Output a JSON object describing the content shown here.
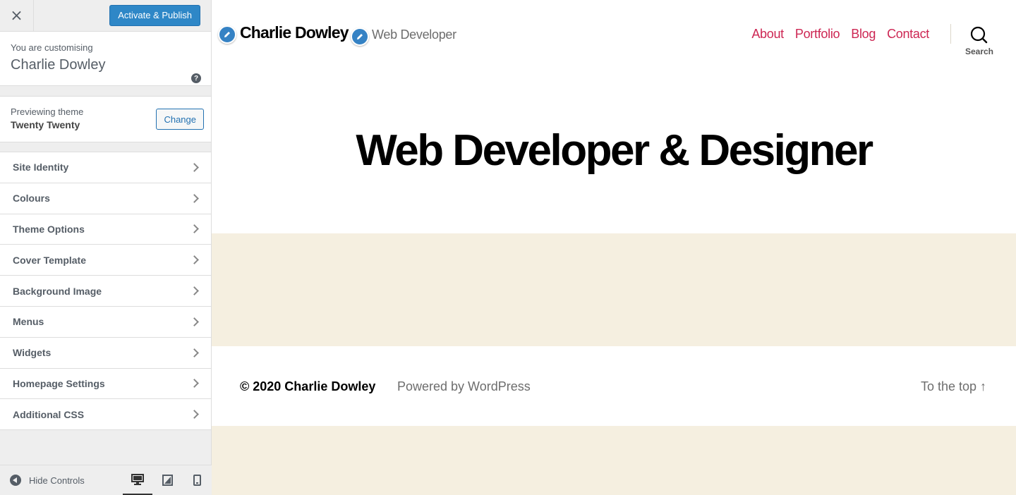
{
  "sidebar": {
    "close_label": "×",
    "publish_label": "Activate & Publish",
    "customising_label": "You are customising",
    "site_name": "Charlie Dowley",
    "help_label": "?",
    "previewing_label": "Previewing theme",
    "theme_name": "Twenty Twenty",
    "change_label": "Change",
    "items": [
      {
        "label": "Site Identity"
      },
      {
        "label": "Colours"
      },
      {
        "label": "Theme Options"
      },
      {
        "label": "Cover Template"
      },
      {
        "label": "Background Image"
      },
      {
        "label": "Menus"
      },
      {
        "label": "Widgets"
      },
      {
        "label": "Homepage Settings"
      },
      {
        "label": "Additional CSS"
      }
    ],
    "hide_controls_label": "Hide Controls",
    "active_device": "desktop"
  },
  "preview": {
    "site_title": "Charlie Dowley",
    "site_description": "Web Developer",
    "nav": [
      {
        "label": "About"
      },
      {
        "label": "Portfolio"
      },
      {
        "label": "Blog"
      },
      {
        "label": "Contact"
      }
    ],
    "search_label": "Search",
    "hero_title": "Web Developer & Designer",
    "footer": {
      "copyright": "© 2020 Charlie Dowley",
      "powered": "Powered by WordPress",
      "to_top": "To the top ↑"
    }
  },
  "colors": {
    "accent": "#cd2653",
    "primary_button": "#2e87c7",
    "band": "#f5efe0",
    "sidebar_bg": "#eeeeee"
  }
}
